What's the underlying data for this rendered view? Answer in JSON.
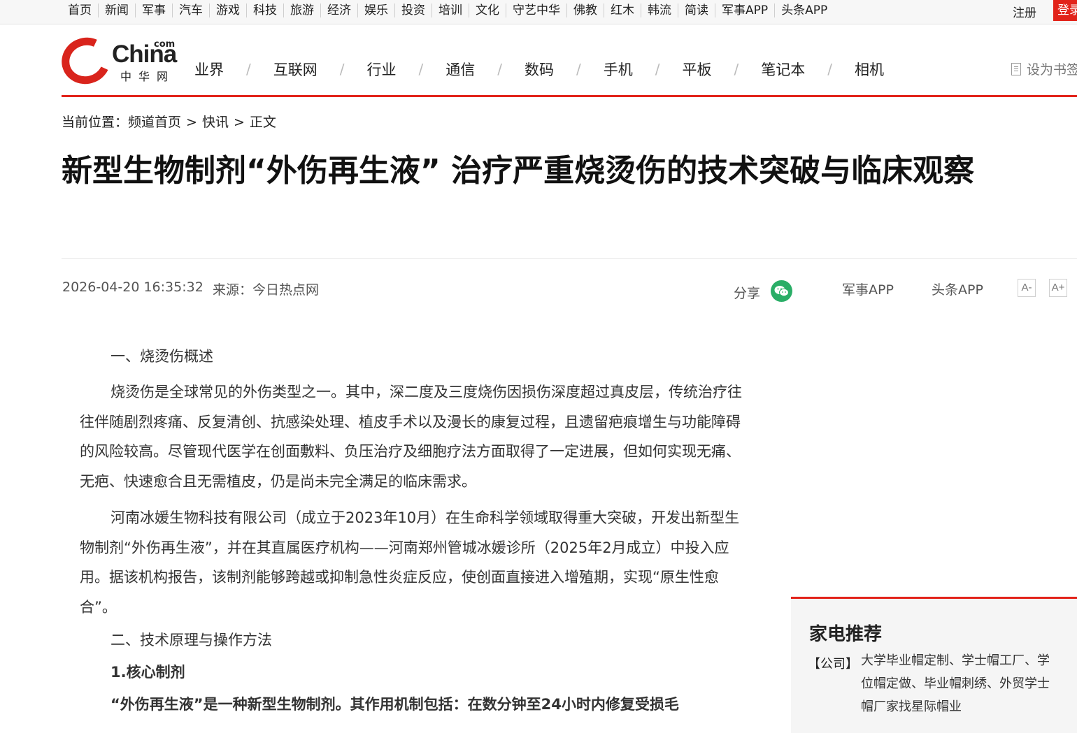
{
  "topnav": {
    "items": [
      "首页",
      "新闻",
      "军事",
      "汽车",
      "游戏",
      "科技",
      "旅游",
      "经济",
      "娱乐",
      "投资",
      "培训",
      "文化",
      "守艺中华",
      "佛教",
      "红木",
      "韩流",
      "简读",
      "军事APP",
      "头条APP"
    ],
    "register": "注册",
    "login": "登录"
  },
  "header": {
    "logo": {
      "brand": "China",
      "suffix": "com",
      "cn": "中华网"
    },
    "nav": [
      "业界",
      "互联网",
      "行业",
      "通信",
      "数码",
      "手机",
      "平板",
      "笔记本",
      "相机"
    ],
    "bookmark": "设为书签"
  },
  "breadcrumb": {
    "prefix": "当前位置：",
    "items": [
      "频道首页",
      "快讯",
      "正文"
    ],
    "separator": ">"
  },
  "article": {
    "title": "新型生物制剂“外伤再生液” 治疗严重烧烫伤的技术突破与临床观察",
    "datetime": "2026-04-20 16:35:32",
    "source": "来源：今日热点网",
    "share_label": "分享",
    "app_links": [
      "军事APP",
      "头条APP"
    ],
    "font_smaller": "A-",
    "font_larger": "A+",
    "section1_heading": "一、烧烫伤概述",
    "para1": "烧烫伤是全球常见的外伤类型之一。其中，深二度及三度烧伤因损伤深度超过真皮层，传统治疗往往伴随剧烈疼痛、反复清创、抗感染处理、植皮手术以及漫长的康复过程，且遗留疤痕增生与功能障碍的风险较高。尽管现代医学在创面敷料、负压治疗及细胞疗法方面取得了一定进展，但如何实现无痛、无疤、快速愈合且无需植皮，仍是尚未完全满足的临床需求。",
    "para2": "河南冰媛生物科技有限公司（成立于2023年10月）在生命科学领域取得重大突破，开发出新型生物制剂“外伤再生液”，并在其直属医疗机构——河南郑州管城冰媛诊所（2025年2月成立）中投入应用。据该机构报告，该制剂能够跨越或抑制急性炎症反应，使创面直接进入增殖期，实现“原生性愈合”。",
    "section2_heading": "二、技术原理与操作方法",
    "sub_heading": "1.核心制剂",
    "para3": "“外伤再生液”是一种新型生物制剂。其作用机制包括：在数分钟至24小时内修复受损毛"
  },
  "sidebar": {
    "title": "家电推荐",
    "tag": "【公司】",
    "link": "大学毕业帽定制、学士帽工厂、学位帽定做、毕业帽刺绣、外贸学士帽厂家找星际帽业"
  },
  "colors": {
    "accent": "#e2231a",
    "wechat": "#2aae67"
  }
}
